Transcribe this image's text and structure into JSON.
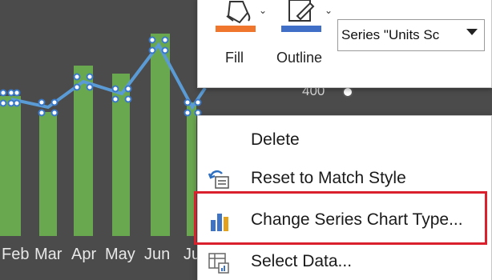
{
  "chart": {
    "months": [
      "Feb",
      "Mar",
      "Apr",
      "May",
      "Jun",
      "Ju"
    ],
    "axis_value": "400"
  },
  "toolbar": {
    "fill_label": "Fill",
    "outline_label": "Outline",
    "series_selected": "Series \"Units Sc",
    "fill_color": "#f0762d",
    "outline_color": "#3f6fc6"
  },
  "context_menu": {
    "items": [
      {
        "label": "Delete",
        "icon": "none"
      },
      {
        "label": "Reset to Match Style",
        "icon": "reset-style-icon"
      },
      {
        "label": "Change Series Chart Type...",
        "icon": "bar-chart-icon"
      },
      {
        "label": "Select Data...",
        "icon": "select-data-icon"
      }
    ]
  },
  "colors": {
    "bar_green": "#6aa84f",
    "line_blue": "#5b9bd5",
    "highlight_red": "#d9202c"
  }
}
